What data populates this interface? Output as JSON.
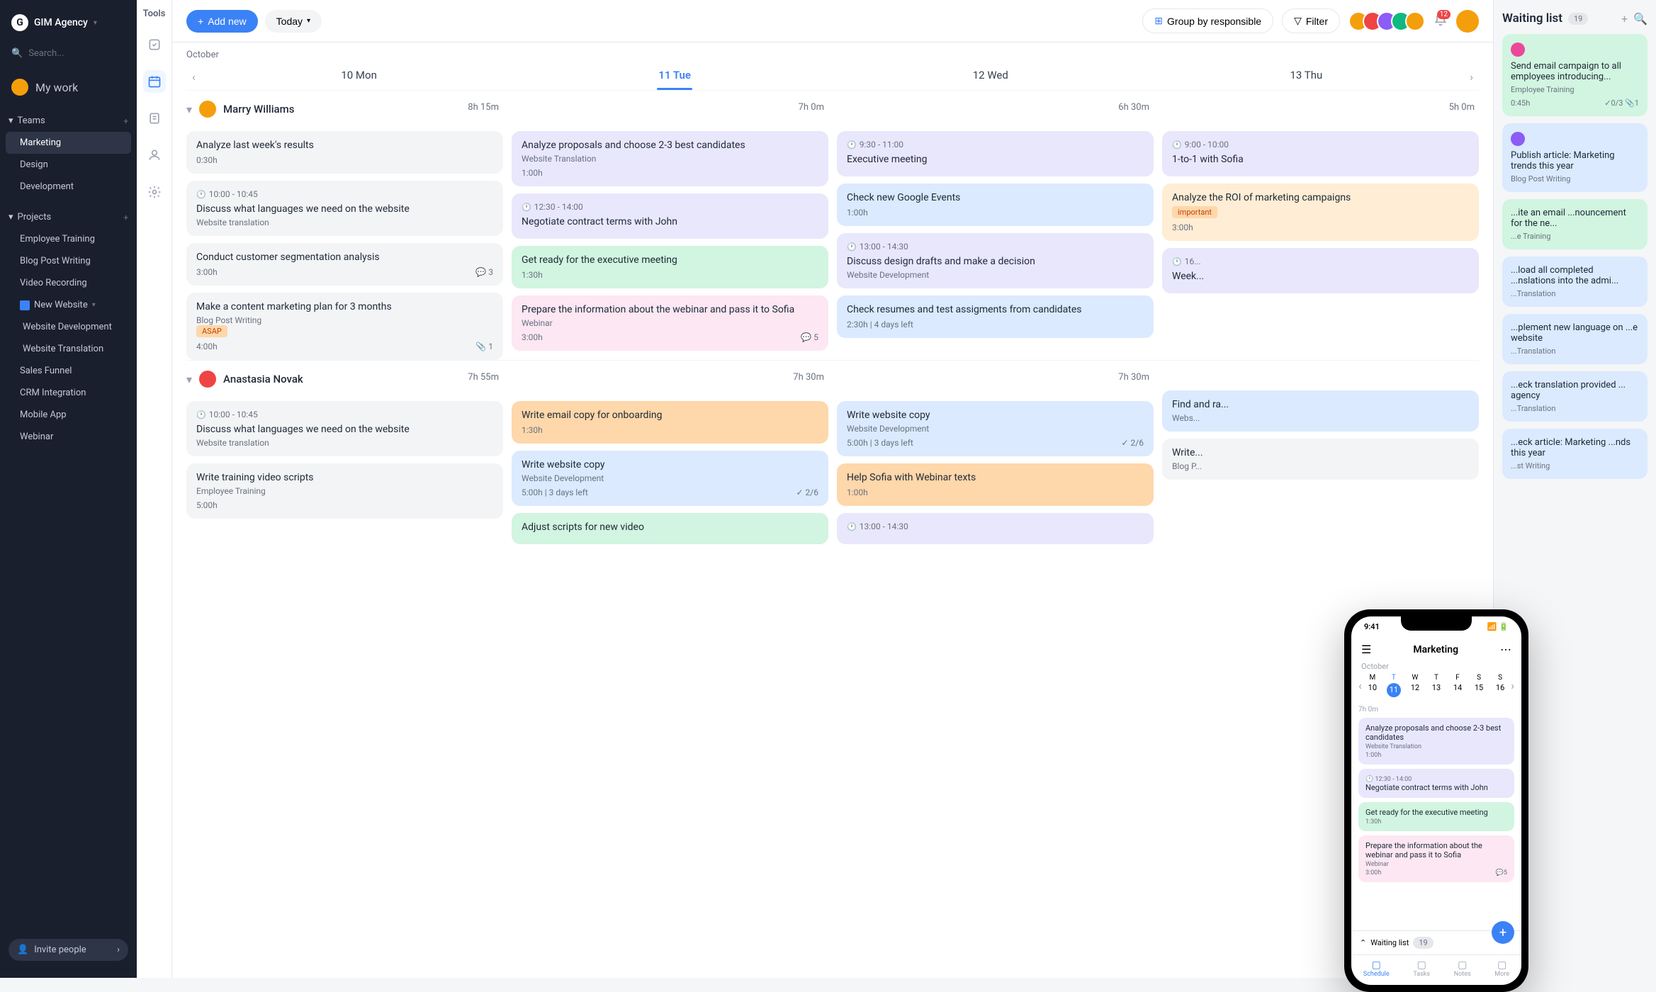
{
  "agency": {
    "logo": "G",
    "name": "GIM Agency"
  },
  "search_placeholder": "Search...",
  "my_work_label": "My work",
  "teams": {
    "label": "Teams",
    "items": [
      "Marketing",
      "Design",
      "Development"
    ]
  },
  "projects": {
    "label": "Projects",
    "items": [
      "Employee Training",
      "Blog Post Writing",
      "Video Recording"
    ],
    "folder": "New Website",
    "folder_items": [
      "Website Development",
      "Website Translation"
    ],
    "more": [
      "Sales Funnel",
      "CRM Integration",
      "Mobile App",
      "Webinar"
    ]
  },
  "invite_label": "Invite people",
  "tools_label": "Tools",
  "topbar": {
    "add": "Add new",
    "today": "Today",
    "group": "Group by responsible",
    "filter": "Filter",
    "notif_count": "12"
  },
  "calendar": {
    "month": "October",
    "days": [
      "10 Mon",
      "11 Tue",
      "12 Wed",
      "13 Thu"
    ],
    "active_day": 1
  },
  "people": [
    {
      "name": "Marry Williams",
      "avatar_color": "#f59e0b",
      "durations": [
        "8h 15m",
        "7h 0m",
        "6h 30m",
        "5h 0m"
      ],
      "cols": [
        [
          {
            "title": "Analyze last week's results",
            "dur": "0:30h",
            "class": "c-gray"
          },
          {
            "time": "10:00 - 10:45",
            "title": "Discuss what languages we need on the website",
            "sub": "Website translation",
            "class": "c-gray"
          },
          {
            "title": "Conduct customer segmentation analysis",
            "dur": "3:00h",
            "comments": "3",
            "class": "c-gray"
          },
          {
            "title": "Make a content marketing plan for 3 months",
            "tag": "ASAP",
            "sub": "Blog Post Writing",
            "dur": "4:00h",
            "attach": "1",
            "class": "c-gray"
          }
        ],
        [
          {
            "title": "Analyze proposals and choose 2-3 best candidates",
            "sub": "Website Translation",
            "dur": "1:00h",
            "class": "c-purple"
          },
          {
            "time": "12:30 - 14:00",
            "title": "Negotiate contract terms with John",
            "class": "c-purple"
          },
          {
            "title": "Get ready for the executive meeting",
            "dur": "1:30h",
            "class": "c-green"
          },
          {
            "title": "Prepare the information about the webinar and pass it to Sofia",
            "sub": "Webinar",
            "dur": "3:00h",
            "comments": "5",
            "class": "c-pink"
          }
        ],
        [
          {
            "time": "9:30 - 11:00",
            "title": "Executive meeting",
            "class": "c-purple"
          },
          {
            "title": "Check new Google Events",
            "dur": "1:00h",
            "class": "c-blue"
          },
          {
            "time": "13:00 - 14:30",
            "title": "Discuss design drafts and make a decision",
            "sub": "Website Development",
            "class": "c-purple"
          },
          {
            "title": "Check resumes and test assigments from candidates",
            "dur_days": "2:30h | 4 days left",
            "class": "c-blue"
          }
        ],
        [
          {
            "time": "9:00 - 10:00",
            "title": "1-to-1 with Sofia",
            "class": "c-purple"
          },
          {
            "title": "Analyze the ROI of marketing campaigns",
            "tag": "important",
            "dur": "3:00h",
            "class": "c-orange-light"
          },
          {
            "time": "16...",
            "title": "Week...",
            "class": "c-purple"
          }
        ]
      ]
    },
    {
      "name": "Anastasia Novak",
      "avatar_color": "#ef4444",
      "durations": [
        "7h 55m",
        "7h 30m",
        "7h 30m",
        ""
      ],
      "cols": [
        [
          {
            "time": "10:00 - 10:45",
            "title": "Discuss what languages we need on the website",
            "sub": "Website translation",
            "class": "c-gray"
          },
          {
            "title": "Write training video scripts",
            "sub": "Employee Training",
            "dur": "5:00h",
            "class": "c-gray"
          }
        ],
        [
          {
            "title": "Write email copy for onboarding",
            "dur": "1:30h",
            "class": "c-orange"
          },
          {
            "title": "Write website copy",
            "sub": "Website Development",
            "dur_days": "5:00h | 3 days left",
            "check": "2/6",
            "class": "c-blue"
          },
          {
            "title": "Adjust scripts for new video",
            "class": "c-green"
          }
        ],
        [
          {
            "title": "Write website copy",
            "sub": "Website Development",
            "dur_days": "5:00h | 3 days left",
            "check": "2/6",
            "class": "c-blue"
          },
          {
            "title": "Help Sofia with Webinar texts",
            "dur": "1:00h",
            "class": "c-orange"
          },
          {
            "time": "13:00 - 14:30",
            "title": "",
            "class": "c-purple"
          }
        ],
        [
          {
            "title": "Find and ra...",
            "sub": "Webs...",
            "class": "c-blue"
          },
          {
            "title": "Write...",
            "sub": "Blog P...",
            "class": "c-gray"
          }
        ]
      ]
    }
  ],
  "waiting": {
    "title": "Waiting list",
    "count": "19",
    "items": [
      {
        "title": "Send email campaign to all employees introducing...",
        "sub": "Employee Training",
        "dur": "0:45h",
        "check": "0/3",
        "attach": "1",
        "class": "c-green",
        "av": "#ec4899"
      },
      {
        "title": "Publish article: Marketing trends this year",
        "sub": "Blog Post Writing",
        "class": "c-blue",
        "av": "#8b5cf6"
      },
      {
        "title": "...ite an email ...nouncement for the ne...",
        "sub": "...e Training",
        "class": "c-green"
      },
      {
        "title": "...load all completed ...nslations into the admi...",
        "sub": "...Translation",
        "class": "c-blue"
      },
      {
        "title": "...plement new language on ...e website",
        "sub": "...Translation",
        "class": "c-blue"
      },
      {
        "title": "...eck translation provided ... agency",
        "sub": "...Translation",
        "class": "c-blue"
      },
      {
        "title": "...eck article: Marketing ...nds this year",
        "sub": "...st Writing",
        "class": "c-blue"
      }
    ]
  },
  "phone": {
    "time": "9:41",
    "title": "Marketing",
    "month": "October",
    "weekdays": [
      "M",
      "T",
      "W",
      "T",
      "F",
      "S",
      "S"
    ],
    "dates": [
      "10",
      "11",
      "12",
      "13",
      "14",
      "15",
      "16"
    ],
    "active": 1,
    "duration": "7h 0m",
    "cards": [
      {
        "title": "Analyze proposals and choose 2-3 best candidates",
        "sub": "Website Translation",
        "dur": "1:00h",
        "class": "c-purple"
      },
      {
        "time": "12:30 - 14:00",
        "title": "Negotiate contract terms with John",
        "class": "c-purple"
      },
      {
        "title": "Get ready for the executive meeting",
        "dur": "1:30h",
        "class": "c-green"
      },
      {
        "title": "Prepare the information about the webinar and pass it to Sofia",
        "sub": "Webinar",
        "dur": "3:00h",
        "comments": "5",
        "class": "c-pink"
      }
    ],
    "waiting_label": "Waiting list",
    "waiting_count": "19",
    "tabs": [
      {
        "label": "Schedule",
        "active": true
      },
      {
        "label": "Tasks"
      },
      {
        "label": "Notes"
      },
      {
        "label": "More"
      }
    ]
  }
}
